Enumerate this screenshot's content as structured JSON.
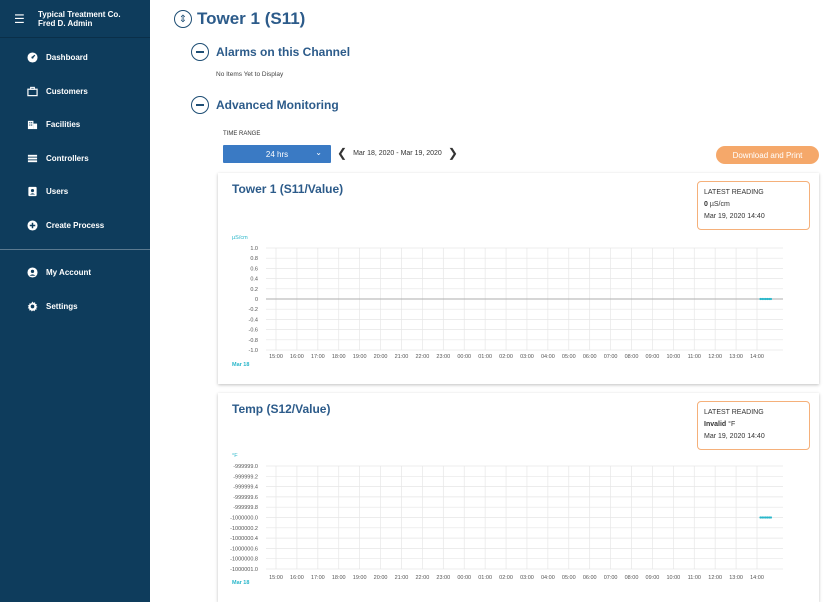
{
  "sidebar": {
    "company": "Typical Treatment Co.",
    "user": "Fred D. Admin",
    "items": [
      {
        "label": "Dashboard",
        "icon": "dashboard-icon"
      },
      {
        "label": "Customers",
        "icon": "briefcase-icon"
      },
      {
        "label": "Facilities",
        "icon": "building-icon"
      },
      {
        "label": "Controllers",
        "icon": "list-icon"
      },
      {
        "label": "Users",
        "icon": "user-badge-icon"
      },
      {
        "label": "Create Process",
        "icon": "plus-circle-icon"
      }
    ],
    "bottom_items": [
      {
        "label": "My Account",
        "icon": "account-circle-icon"
      },
      {
        "label": "Settings",
        "icon": "gear-icon"
      }
    ]
  },
  "page": {
    "title": "Tower 1 (S11)",
    "alarms_title": "Alarms on this Channel",
    "alarms_empty": "No Items Yet to Display",
    "monitoring_title": "Advanced Monitoring",
    "time_range_label": "TIME RANGE",
    "time_range_value": "24 hrs",
    "date_from": "Mar 18, 2020",
    "date_sep": "-",
    "date_to": "Mar 19, 2020",
    "download_label": "Download and Print"
  },
  "colors": {
    "sidebar_bg": "#0e3c5c",
    "accent_blue": "#3a7ac4",
    "title_blue": "#2c5b8a",
    "orange": "#f5a86a",
    "series_cyan": "#2ab7ca"
  },
  "cards": [
    {
      "title": "Tower 1 (S11/Value)",
      "reading_header": "LATEST READING",
      "reading_value": "0",
      "reading_unit": "µS/cm",
      "reading_time": "Mar 19, 2020 14:40"
    },
    {
      "title": "Temp (S12/Value)",
      "reading_header": "LATEST READING",
      "reading_value": "Invalid",
      "reading_unit": "°F",
      "reading_time": "Mar 19, 2020 14:40"
    }
  ],
  "chart_data": [
    {
      "type": "line",
      "ylabel": "µS/cm",
      "date_label": "Mar 18",
      "y_ticks": [
        "1.0",
        "0.8",
        "0.6",
        "0.4",
        "0.2",
        "0",
        "-0.2",
        "-0.4",
        "-0.6",
        "-0.8",
        "-1.0"
      ],
      "x_ticks": [
        "15:00",
        "16:00",
        "17:00",
        "18:00",
        "19:00",
        "20:00",
        "21:00",
        "22:00",
        "23:00",
        "00:00",
        "01:00",
        "02:00",
        "03:00",
        "04:00",
        "05:00",
        "06:00",
        "07:00",
        "08:00",
        "09:00",
        "10:00",
        "11:00",
        "12:00",
        "13:00",
        "14:00"
      ],
      "ylim": [
        -1.0,
        1.0
      ],
      "series": [
        {
          "values_x": [
            "14:10",
            "14:15",
            "14:20",
            "14:25",
            "14:30",
            "14:35",
            "14:40"
          ],
          "values": [
            0,
            0,
            0,
            0,
            0,
            0,
            0
          ]
        }
      ]
    },
    {
      "type": "line",
      "ylabel": "°F",
      "date_label": "Mar 18",
      "y_ticks": [
        "-999999.0",
        "-999999.2",
        "-999999.4",
        "-999999.6",
        "-999999.8",
        "-1000000.0",
        "-1000000.2",
        "-1000000.4",
        "-1000000.6",
        "-1000000.8",
        "-1000001.0"
      ],
      "x_ticks": [
        "15:00",
        "16:00",
        "17:00",
        "18:00",
        "19:00",
        "20:00",
        "21:00",
        "22:00",
        "23:00",
        "00:00",
        "01:00",
        "02:00",
        "03:00",
        "04:00",
        "05:00",
        "06:00",
        "07:00",
        "08:00",
        "09:00",
        "10:00",
        "11:00",
        "12:00",
        "13:00",
        "14:00"
      ],
      "ylim": [
        -1000001.0,
        -999999.0
      ],
      "series": [
        {
          "values_x": [
            "14:10",
            "14:15",
            "14:20",
            "14:25",
            "14:30",
            "14:35",
            "14:40"
          ],
          "values": [
            -1000000.0,
            -1000000.0,
            -1000000.0,
            -1000000.0,
            -1000000.0,
            -1000000.0,
            -1000000.0
          ]
        }
      ]
    }
  ]
}
